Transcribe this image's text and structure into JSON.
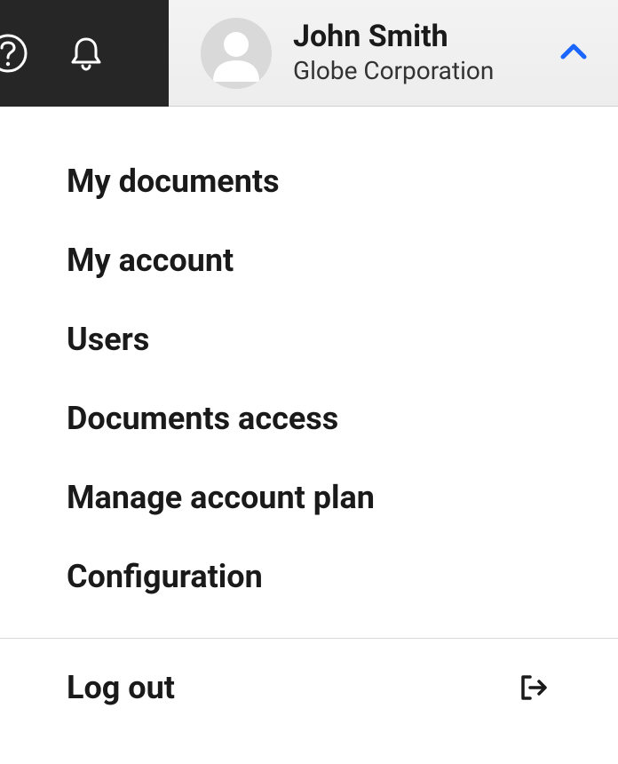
{
  "header": {
    "user_name": "John Smith",
    "organization": "Globe Corporation"
  },
  "menu": {
    "items": [
      {
        "label": "My documents"
      },
      {
        "label": "My account"
      },
      {
        "label": "Users"
      },
      {
        "label": "Documents access"
      },
      {
        "label": "Manage account plan"
      },
      {
        "label": "Configuration"
      }
    ],
    "logout_label": "Log out"
  }
}
